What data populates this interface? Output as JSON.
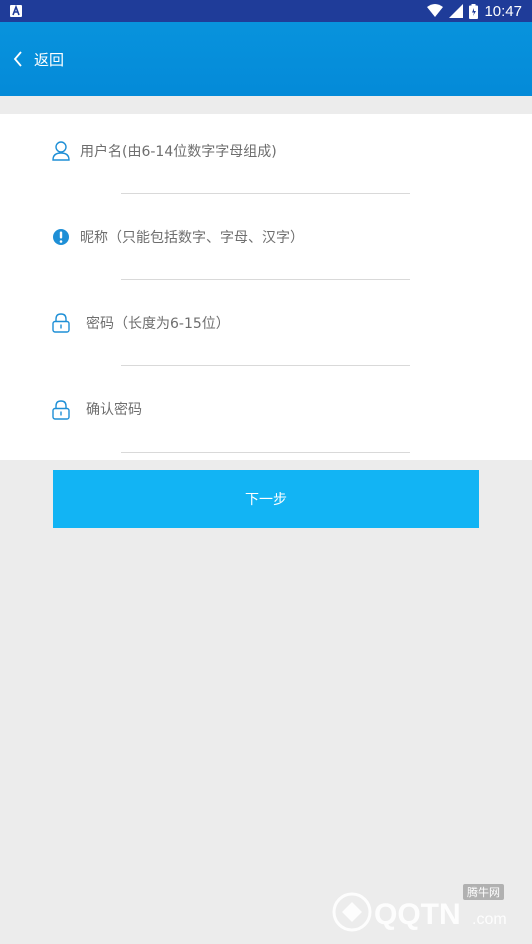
{
  "status_bar": {
    "time": "10:47",
    "left_icon": "notification-a-icon",
    "wifi_icon": "wifi-icon",
    "signal_icon": "signal-icon",
    "battery_icon": "battery-icon",
    "background": "#1f3c99"
  },
  "app_bar": {
    "back_label": "返回",
    "background": "#0893dd"
  },
  "form": {
    "fields": [
      {
        "icon": "user-icon",
        "placeholder": "用户名(由6-14位数字字母组成)"
      },
      {
        "icon": "exclamation-icon",
        "placeholder": "昵称（只能包括数字、字母、汉字）"
      },
      {
        "icon": "lock-icon",
        "placeholder": "密码（长度为6-15位）"
      },
      {
        "icon": "lock-icon",
        "placeholder": "确认密码"
      }
    ]
  },
  "next_button": {
    "label": "下一步",
    "color": "#12b4f4"
  },
  "watermark": {
    "site_text": "腾牛网",
    "logo_text": "QQTN.com"
  }
}
